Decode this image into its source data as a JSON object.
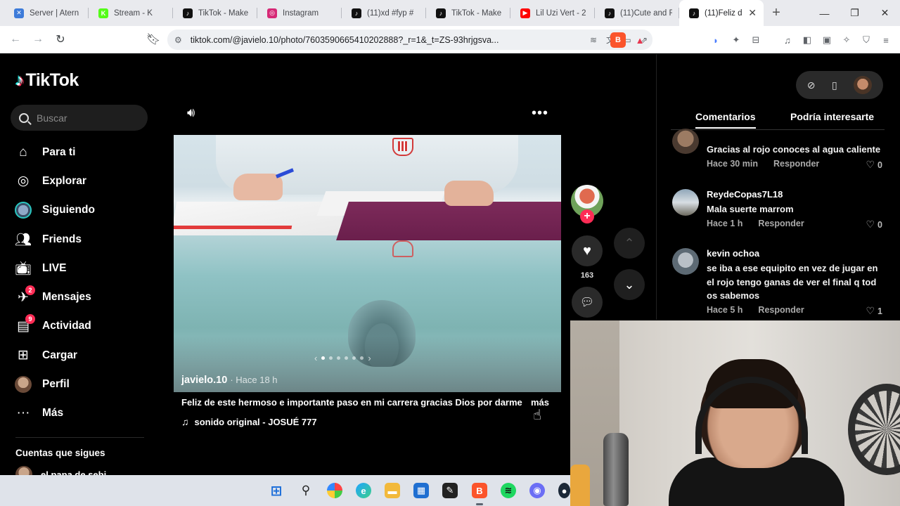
{
  "browser": {
    "tabs": [
      {
        "label": "Server | Atern",
        "color": "#3d7bd9",
        "glyph": "✕"
      },
      {
        "label": "Stream - K",
        "color": "#53fc18",
        "glyph": "K"
      },
      {
        "label": "TikTok - Make",
        "color": "#111111",
        "glyph": "♪"
      },
      {
        "label": "Instagram",
        "color": "#d62976",
        "glyph": "◎"
      },
      {
        "label": "(11)xd #fyp #",
        "color": "#111111",
        "glyph": "♪"
      },
      {
        "label": "TikTok - Make",
        "color": "#111111",
        "glyph": "♪"
      },
      {
        "label": "Lil Uzi Vert - 2",
        "color": "#ff0000",
        "glyph": "▶"
      },
      {
        "label": "(11)Cute and F",
        "color": "#111111",
        "glyph": "♪"
      },
      {
        "label": "(11)Feliz d",
        "color": "#111111",
        "glyph": "♪",
        "active": true
      }
    ],
    "url": "tiktok.com/@javielo.10/photo/7603590665410202888?_r=1&_t=ZS-93hrjgsva..."
  },
  "sidebar": {
    "logo": "TikTok",
    "search_placeholder": "Buscar",
    "items": [
      {
        "label": "Para ti",
        "icon": "home-icon"
      },
      {
        "label": "Explorar",
        "icon": "compass-icon"
      },
      {
        "label": "Siguiendo",
        "icon": "following-avatar-icon"
      },
      {
        "label": "Friends",
        "icon": "friends-icon"
      },
      {
        "label": "LIVE",
        "icon": "live-tv-icon"
      },
      {
        "label": "Mensajes",
        "icon": "send-icon",
        "badge": "2"
      },
      {
        "label": "Actividad",
        "icon": "activity-icon",
        "badge": "9"
      },
      {
        "label": "Cargar",
        "icon": "upload-plus-icon"
      },
      {
        "label": "Perfil",
        "icon": "profile-avatar-icon"
      },
      {
        "label": "Más",
        "icon": "more-dots-icon"
      }
    ],
    "following_title": "Cuentas que sigues",
    "following_first": "el papa de sebi"
  },
  "post": {
    "author": "javielo.10",
    "ago": "· Hace 18 h",
    "caption": "Feliz de este hermoso e importante paso en mi carrera gracias Dios por darme",
    "more_label": "más",
    "sound": "sonido original - JOSUÉ 777",
    "likes": "163"
  },
  "comments_panel": {
    "tabs": [
      "Comentarios",
      "Podría interesarte"
    ],
    "comments": [
      {
        "user": "",
        "text": "Gracias al rojo conoces al agua caliente",
        "time": "Hace 30 min",
        "reply": "Responder",
        "likes": "0"
      },
      {
        "user": "ReydeCopas7L18",
        "text": "Mala suerte marrom",
        "time": "Hace 1 h",
        "reply": "Responder",
        "likes": "0"
      },
      {
        "user": "kevin ochoa",
        "text": "se iba a ese equipito en vez de jugar en el rojo tengo ganas de ver el final q tod os sabemos",
        "time": "Hace 5 h",
        "reply": "Responder",
        "likes": "1"
      }
    ]
  },
  "colors": {
    "accent": "#fe2c55",
    "background": "#000000"
  }
}
